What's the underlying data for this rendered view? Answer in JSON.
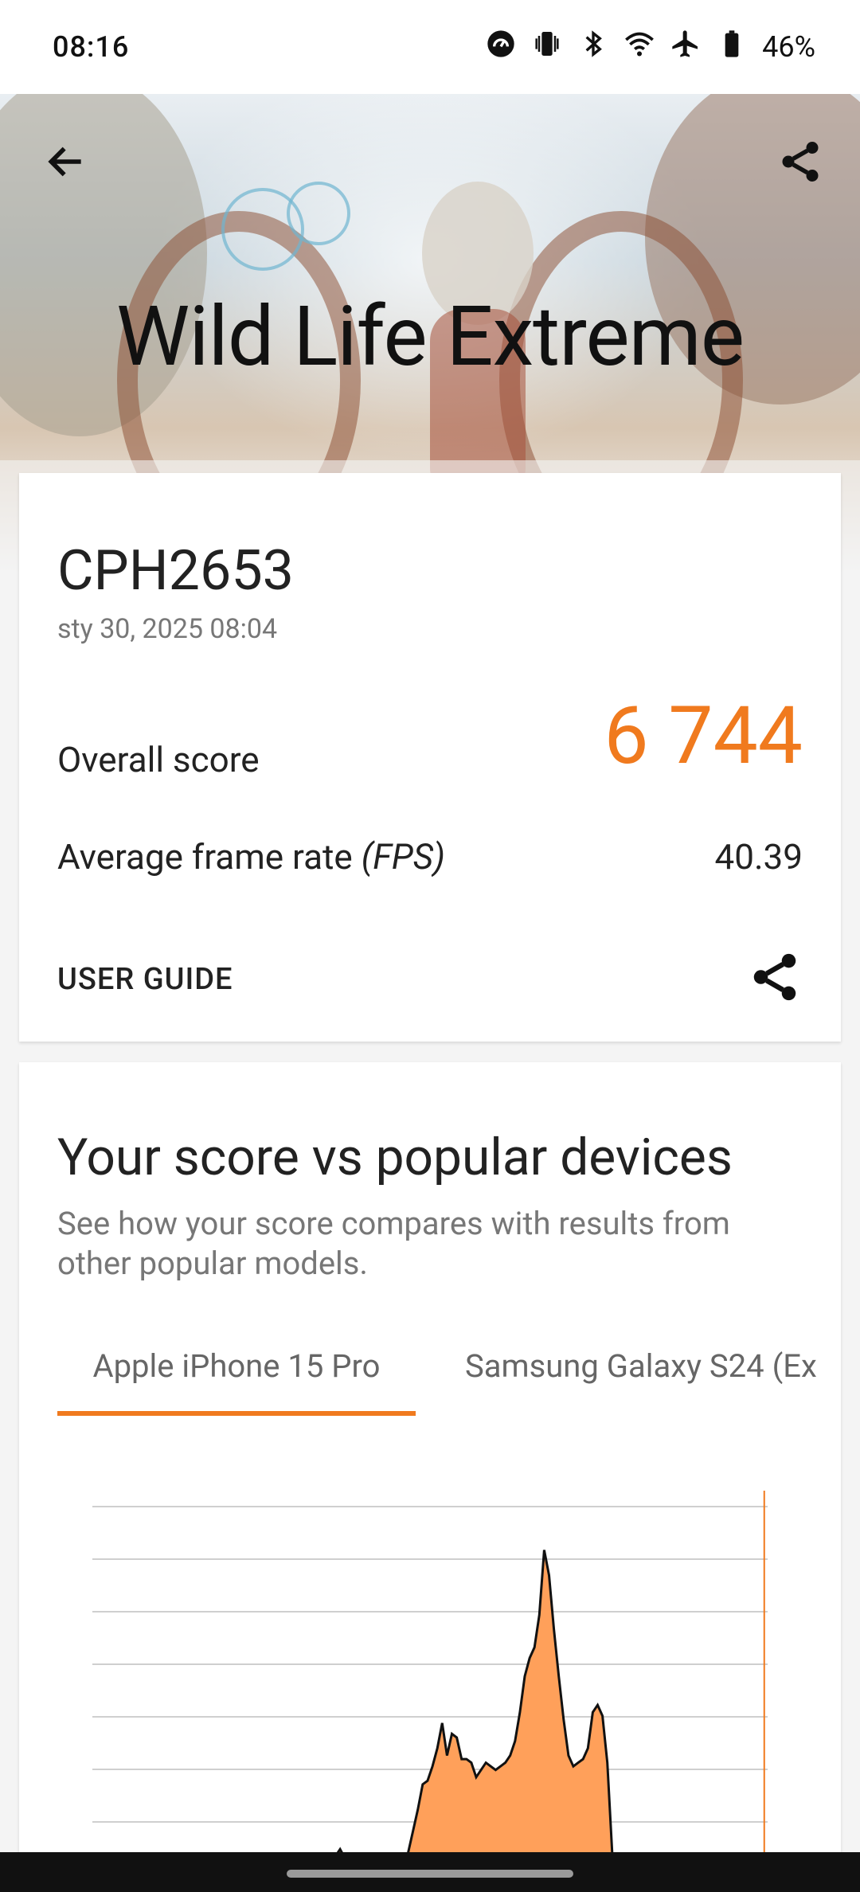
{
  "status_bar": {
    "time": "08:16",
    "battery": "46%",
    "icons": [
      "data-saver-icon",
      "vibrate-icon",
      "bluetooth-icon",
      "wifi-icon",
      "airplane-icon",
      "battery-icon"
    ]
  },
  "header": {
    "title": "Wild Life Extreme",
    "back_icon": "arrow-back-icon",
    "share_icon": "share-icon"
  },
  "result": {
    "device": "CPH2653",
    "date": "sty 30, 2025 08:04",
    "overall_score_label": "Overall score",
    "overall_score": "6 744",
    "fps_label": "Average frame rate",
    "fps_unit": "(FPS)",
    "fps_value": "40.39",
    "user_guide": "USER GUIDE",
    "accent_color": "#f07a1e"
  },
  "comparison": {
    "title": "Your score vs popular devices",
    "subtitle": "See how your score compares with results from other popular models.",
    "tabs": [
      {
        "label": "Apple iPhone 15 Pro",
        "selected": true
      },
      {
        "label": "Samsung Galaxy S24 (Ex",
        "selected": false
      }
    ]
  },
  "chart_data": {
    "type": "area",
    "fill_color": "#ffa05a",
    "line_color": "#111111",
    "marker_color": "#f07a1e",
    "grid": true,
    "gridline_count": 8,
    "values": [
      0,
      0,
      0,
      0,
      0,
      0,
      0,
      0,
      0,
      0,
      0,
      0,
      0,
      0,
      0,
      0,
      0,
      0,
      0,
      0,
      0,
      0,
      0,
      0,
      0,
      0,
      0,
      0,
      0,
      0,
      0,
      0,
      0,
      0,
      0,
      0,
      0,
      0,
      0,
      0,
      0,
      0.005,
      0.005,
      0.005,
      0.01,
      0.005,
      0.01,
      0.01,
      0.02,
      0.03,
      0.05,
      0.07,
      0.045,
      0.02,
      0.01,
      0.005,
      0.005,
      0.005,
      0.005,
      0.01,
      0.01,
      0.01,
      0.015,
      0.02,
      0.03,
      0.06,
      0.12,
      0.18,
      0.25,
      0.26,
      0.3,
      0.35,
      0.42,
      0.33,
      0.39,
      0.38,
      0.32,
      0.32,
      0.31,
      0.27,
      0.29,
      0.31,
      0.3,
      0.29,
      0.3,
      0.31,
      0.33,
      0.37,
      0.45,
      0.55,
      0.6,
      0.63,
      0.72,
      0.9,
      0.83,
      0.68,
      0.55,
      0.43,
      0.33,
      0.3,
      0.31,
      0.32,
      0.35,
      0.45,
      0.47,
      0.44,
      0.31,
      0.06,
      0.01,
      0,
      0,
      0,
      0,
      0,
      0,
      0,
      0,
      0,
      0,
      0,
      0,
      0,
      0,
      0,
      0,
      0,
      0,
      0,
      0,
      0,
      0,
      0,
      0,
      0,
      0,
      0,
      0,
      0,
      0,
      0
    ],
    "marker_position_fraction": 0.995
  }
}
